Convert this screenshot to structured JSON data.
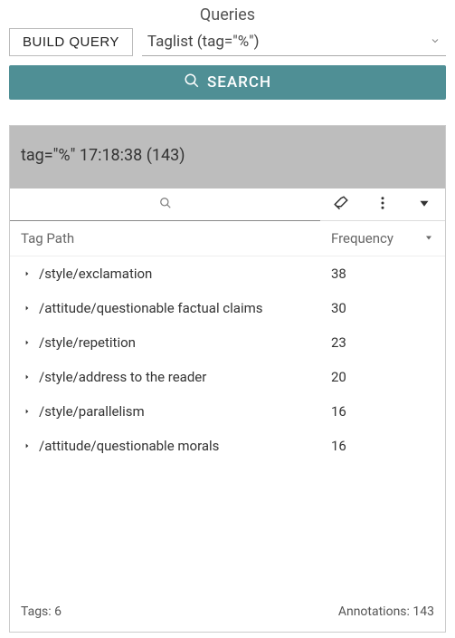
{
  "title": "Queries",
  "buildQuery": "BUILD QUERY",
  "selectedQuery": "Taglist (tag=\"%\")",
  "searchLabel": "SEARCH",
  "resultHeader": "tag=\"%\" 17:18:38 (143)",
  "columns": {
    "tagPath": "Tag Path",
    "frequency": "Frequency"
  },
  "rows": [
    {
      "path": "/style/exclamation",
      "freq": "38"
    },
    {
      "path": "/attitude/questionable factual claims",
      "freq": "30"
    },
    {
      "path": "/style/repetition",
      "freq": "23"
    },
    {
      "path": "/style/address to the reader",
      "freq": "20"
    },
    {
      "path": "/style/parallelism",
      "freq": "16"
    },
    {
      "path": "/attitude/questionable morals",
      "freq": "16"
    }
  ],
  "footer": {
    "tags": "Tags: 6",
    "annotations": "Annotations: 143"
  }
}
